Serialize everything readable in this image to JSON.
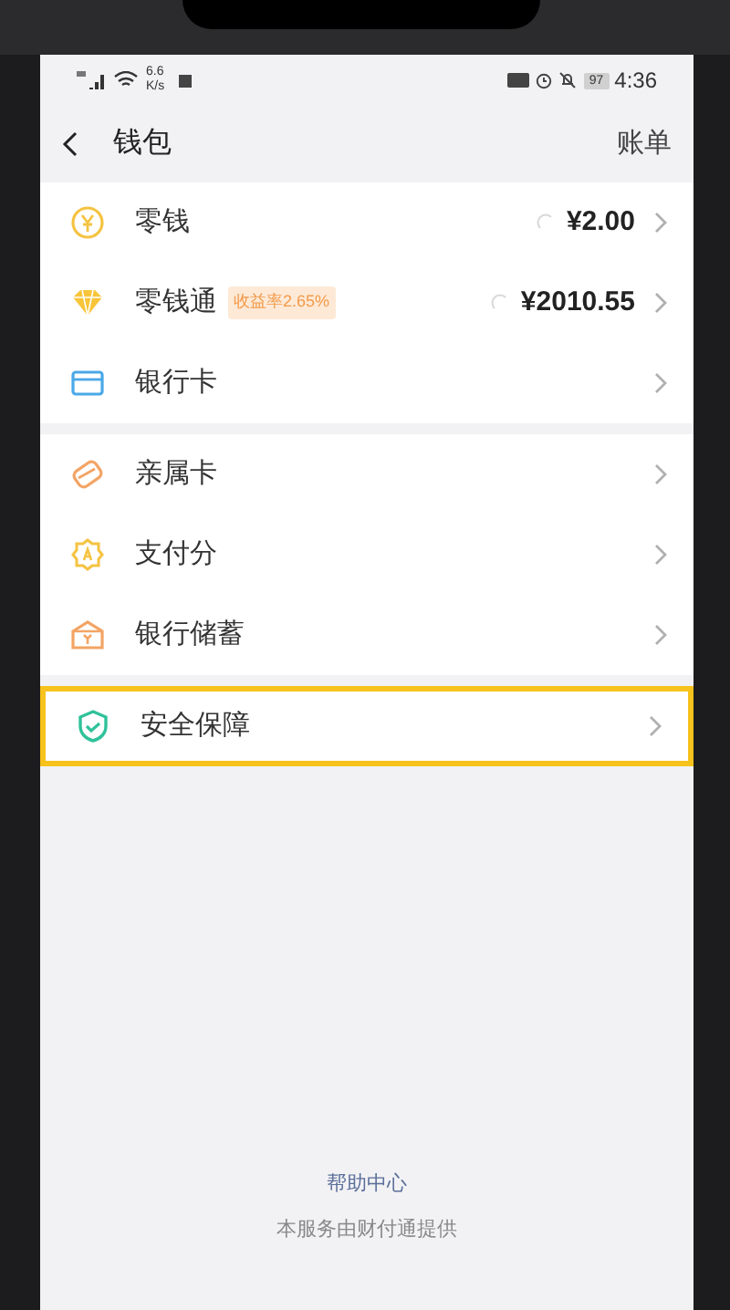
{
  "status_bar": {
    "speed": "6.6",
    "speed_unit": "K/s",
    "battery": "97",
    "time": "4:36"
  },
  "header": {
    "title": "钱包",
    "action": "账单"
  },
  "groups": [
    {
      "items": [
        {
          "kind": "change",
          "label": "零钱",
          "amount": "¥2.00",
          "loading": true,
          "highlighted": false
        },
        {
          "kind": "fund",
          "label": "零钱通",
          "badge": "收益率2.65%",
          "amount": "¥2010.55",
          "loading": true,
          "highlighted": false
        },
        {
          "kind": "card",
          "label": "银行卡",
          "highlighted": false
        }
      ]
    },
    {
      "items": [
        {
          "kind": "family",
          "label": "亲属卡",
          "highlighted": false
        },
        {
          "kind": "score",
          "label": "支付分",
          "highlighted": false
        },
        {
          "kind": "savings",
          "label": "银行储蓄",
          "highlighted": false
        }
      ]
    },
    {
      "items": [
        {
          "kind": "security",
          "label": "安全保障",
          "highlighted": true
        }
      ]
    }
  ],
  "footer": {
    "link": "帮助中心",
    "note": "本服务由财付通提供"
  }
}
